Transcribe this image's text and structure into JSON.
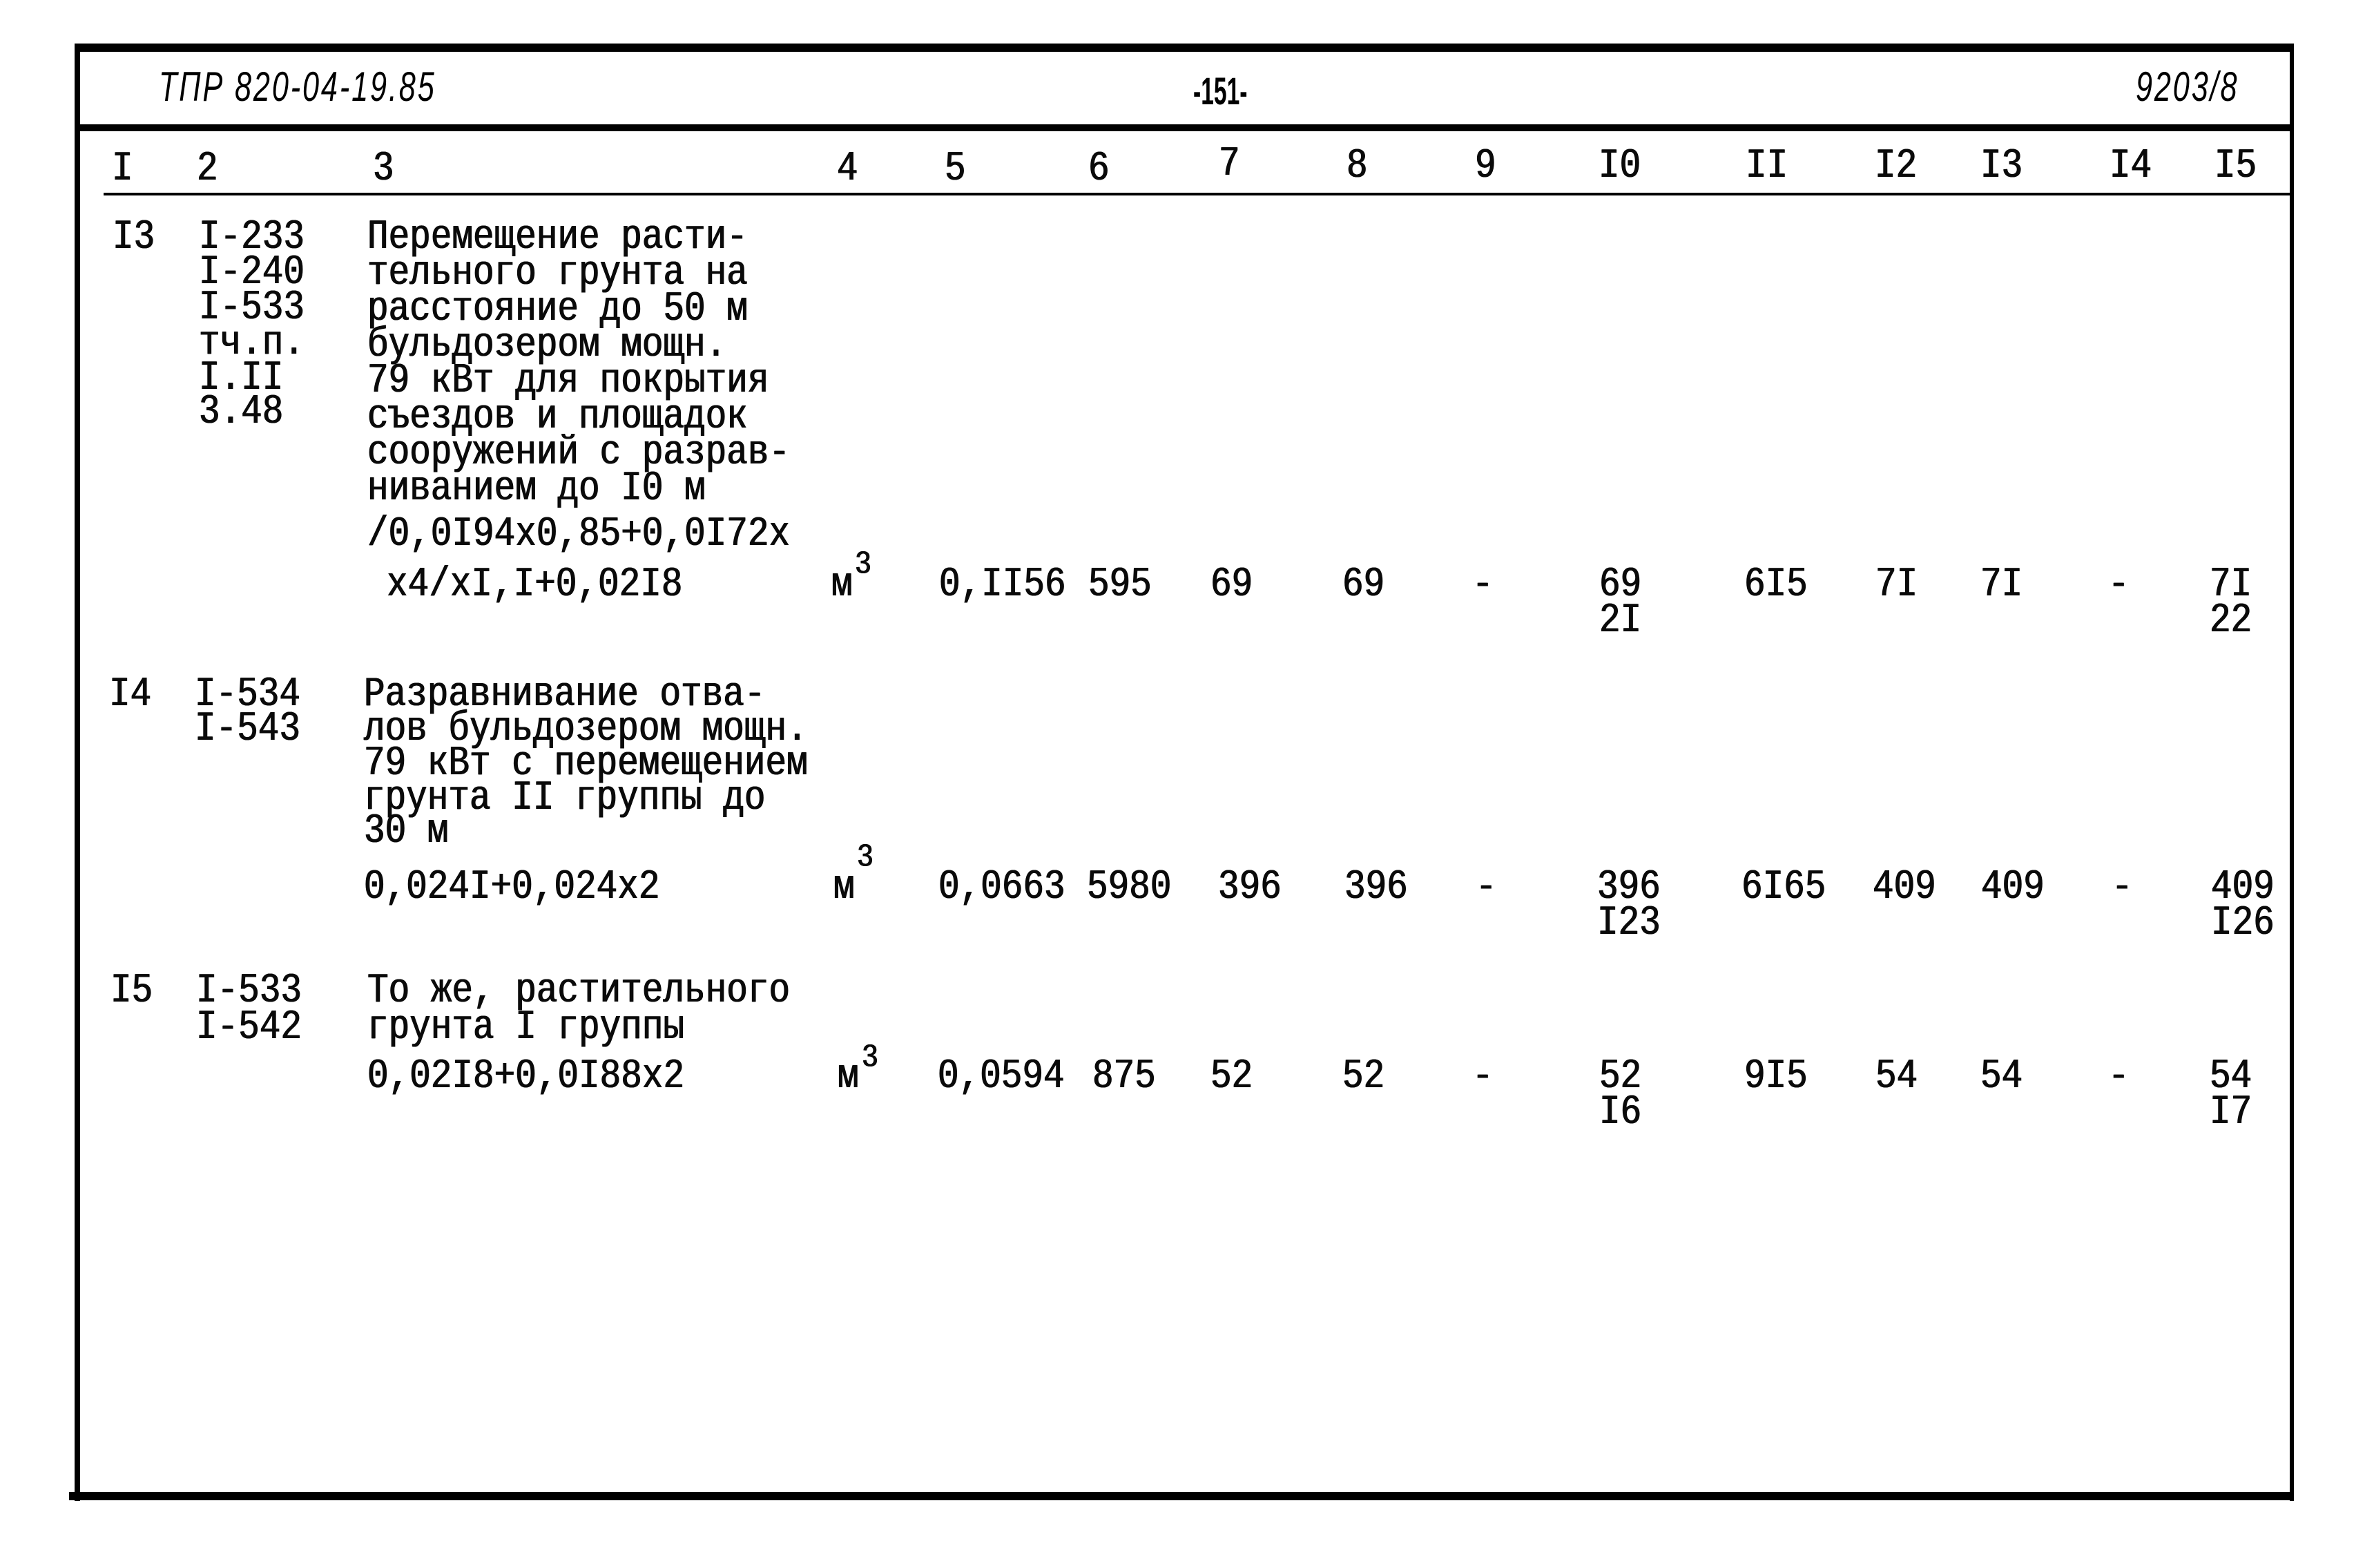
{
  "header": {
    "doc_code": "ТПР 820-04-19.85",
    "page_number": "-151-",
    "sheet_number": "9203/8"
  },
  "columns": [
    "I",
    "2",
    "3",
    "4",
    "5",
    "6",
    "7",
    "8",
    "9",
    "I0",
    "II",
    "I2",
    "I3",
    "I4",
    "I5"
  ],
  "rows": [
    {
      "num": "I3",
      "codes": [
        "I-233",
        "I-240",
        "I-533",
        "тч.п.",
        "I.II",
        "3.48"
      ],
      "description": [
        "Перемещение расти-",
        "тельного грунта на",
        "расстояние до 50 м",
        "бульдозером мощн.",
        "79 кВт для покрытия",
        "съездов и площадок",
        "сооружений с разрав-",
        "ниванием до I0 м"
      ],
      "formula": [
        "/0,0I94x0,85+0,0I72x",
        "x4/xI,I+0,02I8"
      ],
      "unit": "м",
      "unit_sup": "3",
      "c5": "0,II56",
      "c6": "595",
      "c7": "69",
      "c8": "69",
      "c9": "-",
      "c10": [
        "69",
        "2I"
      ],
      "c11": "6I5",
      "c12": "7I",
      "c13": "7I",
      "c14": "-",
      "c15": [
        "7I",
        "22"
      ]
    },
    {
      "num": "I4",
      "codes": [
        "I-534",
        "I-543"
      ],
      "description": [
        "Разравнивание отва-",
        "лов бульдозером мощн.",
        "79 кВт с перемещением",
        "грунта II группы до",
        "30 м"
      ],
      "formula": [
        "0,024I+0,024x2"
      ],
      "unit": "м",
      "unit_sup": "3",
      "c5": "0,0663",
      "c6": "5980",
      "c7": "396",
      "c8": "396",
      "c9": "-",
      "c10": [
        "396",
        "I23"
      ],
      "c11": "6I65",
      "c12": "409",
      "c13": "409",
      "c14": "-",
      "c15": [
        "409",
        "I26"
      ]
    },
    {
      "num": "I5",
      "codes": [
        "I-533",
        "I-542"
      ],
      "description": [
        "То же, растительного",
        "грунта I группы"
      ],
      "formula": [
        "0,02I8+0,0I88x2"
      ],
      "unit": "м",
      "unit_sup": "3",
      "c5": "0,0594",
      "c6": "875",
      "c7": "52",
      "c8": "52",
      "c9": "-",
      "c10": [
        "52",
        "I6"
      ],
      "c11": "9I5",
      "c12": "54",
      "c13": "54",
      "c14": "-",
      "c15": [
        "54",
        "I7"
      ]
    }
  ]
}
